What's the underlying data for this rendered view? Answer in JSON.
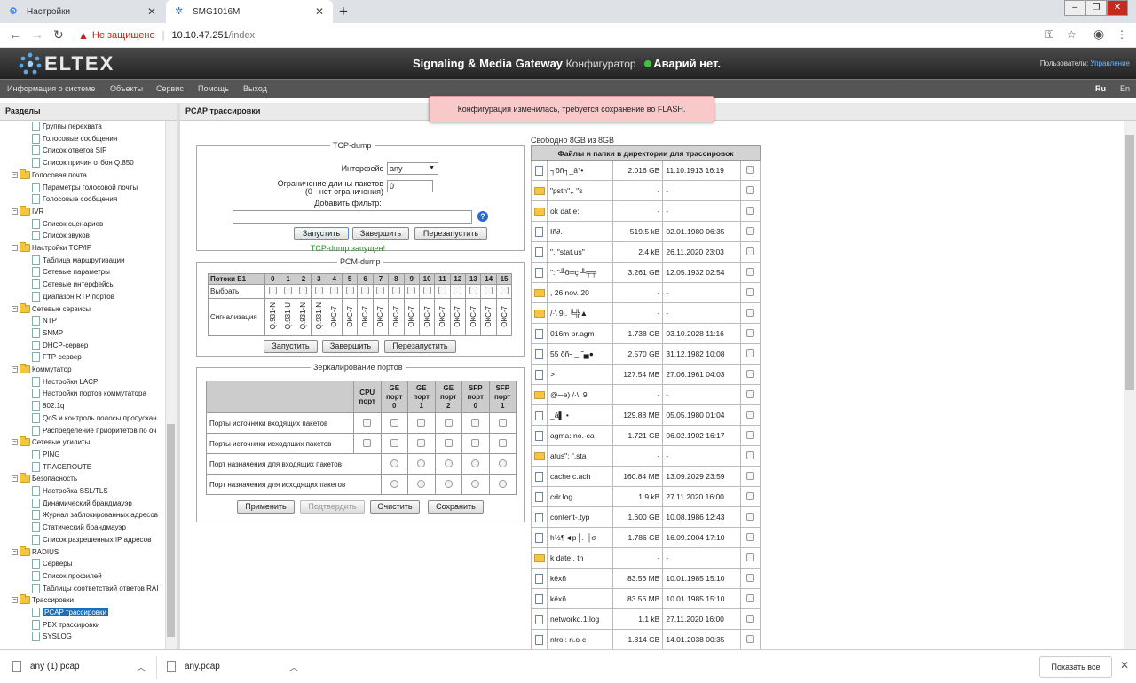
{
  "browser": {
    "tabs": [
      {
        "title": "Настройки",
        "active": false
      },
      {
        "title": "SMG1016M",
        "active": true
      }
    ],
    "insecure_label": "Не защищено",
    "url_host": "10.10.47.251",
    "url_path": "/index"
  },
  "header": {
    "logo_text": "ELTEX",
    "title": "Signaling & Media Gateway",
    "subtitle": "Конфигуратор",
    "alarm": "Аварий нет.",
    "user_label": "Пользователи:",
    "user_name": "Управление"
  },
  "menu": {
    "items": [
      "Информация о системе",
      "Объекты",
      "Сервис",
      "Помощь",
      "Выход"
    ],
    "lang_ru": "Ru",
    "lang_en": "En"
  },
  "sidebar": {
    "title": "Разделы",
    "tree": [
      {
        "type": "leaf",
        "label": "Группы перехвата"
      },
      {
        "type": "leaf",
        "label": "Голосовые сообщения"
      },
      {
        "type": "leaf",
        "label": "Список ответов SIP"
      },
      {
        "type": "leaf",
        "label": "Список причин отбоя Q.850"
      },
      {
        "type": "folder",
        "label": "Голосовая почта"
      },
      {
        "type": "leaf",
        "label": "Параметры голосовой почты"
      },
      {
        "type": "leaf",
        "label": "Голосовые сообщения"
      },
      {
        "type": "folder",
        "label": "IVR"
      },
      {
        "type": "leaf",
        "label": "Список сценариев"
      },
      {
        "type": "leaf",
        "label": "Список звуков"
      },
      {
        "type": "folder",
        "label": "Настройки TCP/IP"
      },
      {
        "type": "leaf",
        "label": "Таблица маршрутизации"
      },
      {
        "type": "leaf",
        "label": "Сетевые параметры"
      },
      {
        "type": "leaf",
        "label": "Сетевые интерфейсы"
      },
      {
        "type": "leaf",
        "label": "Диапазон RTP портов"
      },
      {
        "type": "folder",
        "label": "Сетевые сервисы"
      },
      {
        "type": "leaf",
        "label": "NTP"
      },
      {
        "type": "leaf",
        "label": "SNMP"
      },
      {
        "type": "leaf",
        "label": "DHCP-сервер"
      },
      {
        "type": "leaf",
        "label": "FTP-сервер"
      },
      {
        "type": "folder",
        "label": "Коммутатор"
      },
      {
        "type": "leaf",
        "label": "Настройки LACP"
      },
      {
        "type": "leaf",
        "label": "Настройки портов коммутатора"
      },
      {
        "type": "leaf",
        "label": "802.1q"
      },
      {
        "type": "leaf",
        "label": "QoS и контроль полосы пропускан"
      },
      {
        "type": "leaf",
        "label": "Распределение приоритетов по оч"
      },
      {
        "type": "folder",
        "label": "Сетевые утилиты"
      },
      {
        "type": "leaf",
        "label": "PING"
      },
      {
        "type": "leaf",
        "label": "TRACEROUTE"
      },
      {
        "type": "folder",
        "label": "Безопасность"
      },
      {
        "type": "leaf",
        "label": "Настройка SSL/TLS"
      },
      {
        "type": "leaf",
        "label": "Динамический брандмауэр"
      },
      {
        "type": "leaf",
        "label": "Журнал заблокированных адресов"
      },
      {
        "type": "leaf",
        "label": "Статический брандмауэр"
      },
      {
        "type": "leaf",
        "label": "Список разрешенных IP адресов"
      },
      {
        "type": "folder",
        "label": "RADIUS"
      },
      {
        "type": "leaf",
        "label": "Серверы"
      },
      {
        "type": "leaf",
        "label": "Список профилей"
      },
      {
        "type": "leaf",
        "label": "Таблицы соответствий ответов RAI"
      },
      {
        "type": "folder",
        "label": "Трассировки"
      },
      {
        "type": "leaf",
        "label": "PCAP трассировки",
        "selected": true
      },
      {
        "type": "leaf",
        "label": "PBX трассировки"
      },
      {
        "type": "leaf",
        "label": "SYSLOG"
      }
    ]
  },
  "main": {
    "title": "PCAP трассировки",
    "toast": "Конфигурация изменилась, требуется сохранение во FLASH.",
    "tcpdump": {
      "legend": "TCP-dump",
      "iface_label": "Интерфейс",
      "iface_value": "any",
      "limit_label1": "Ограничение длины пакетов",
      "limit_label2": "(0 - нет ограничения)",
      "limit_value": "0",
      "filter_label": "Добавить фильтр:",
      "filter_value": "",
      "start": "Запустить",
      "stop": "Завершить",
      "restart": "Перезапустить",
      "status": "TCP-dump запущен!"
    },
    "pcmdump": {
      "legend": "PCM-dump",
      "header_label": "Потоки E1",
      "streams": [
        "0",
        "1",
        "2",
        "3",
        "4",
        "5",
        "6",
        "7",
        "8",
        "9",
        "10",
        "11",
        "12",
        "13",
        "14",
        "15"
      ],
      "select_label": "Выбрать",
      "sig_label": "Сигнализация",
      "signaling": [
        "Q.931-N",
        "Q.931-U",
        "Q.931-N",
        "Q.931-N",
        "ОКС-7",
        "ОКС-7",
        "ОКС-7",
        "ОКС-7",
        "ОКС-7",
        "ОКС-7",
        "ОКС-7",
        "ОКС-7",
        "ОКС-7",
        "ОКС-7",
        "ОКС-7",
        "ОКС-7"
      ],
      "start": "Запустить",
      "stop": "Завершить",
      "restart": "Перезапустить"
    },
    "mirror": {
      "legend": "Зеркалирование портов",
      "cols": [
        [
          "CPU",
          "порт"
        ],
        [
          "GE",
          "порт",
          "0"
        ],
        [
          "GE",
          "порт",
          "1"
        ],
        [
          "GE",
          "порт",
          "2"
        ],
        [
          "SFP",
          "порт",
          "0"
        ],
        [
          "SFP",
          "порт",
          "1"
        ]
      ],
      "rows": [
        {
          "label": "Порты источники входящих пакетов",
          "kind": "check"
        },
        {
          "label": "Порты источники исходящих пакетов",
          "kind": "check"
        },
        {
          "label": "Порт назначения для входящих пакетов",
          "kind": "radio"
        },
        {
          "label": "Порт назначения для исходящих пакетов",
          "kind": "radio"
        }
      ],
      "apply": "Применить",
      "confirm": "Подтвердить",
      "clear": "Очистить",
      "save": "Сохранить"
    },
    "files": {
      "free": "Свободно 8GB из 8GB",
      "header": "Файлы и папки в директории для трассировок",
      "rows": [
        {
          "t": "file",
          "name": "┐õñ┐_â°•",
          "size": "2.016 GB",
          "date": "11.10.1913 16:19"
        },
        {
          "t": "folder",
          "name": "\"pstn\",. \"s",
          "size": "-",
          "date": "-"
        },
        {
          "t": "folder",
          "name": "ok dat.e:",
          "size": "-",
          "date": "-"
        },
        {
          "t": "file",
          "name": "Iñ∂.─",
          "size": "519.5 kB",
          "date": "02.01.1980 06:35"
        },
        {
          "t": "file",
          "name": "\", \"stat.us\"",
          "size": "2.4 kB",
          "date": "26.11.2020 23:03"
        },
        {
          "t": "file",
          "name": "\": \"╨õ╤ç ╨╤╤",
          "size": "3.261 GB",
          "date": "12.05.1932 02:54"
        },
        {
          "t": "folder",
          "name": ", 26 nov. 20",
          "size": "-",
          "date": "-"
        },
        {
          "t": "folder",
          "name": "/·\\ 9|. ╚╬▲",
          "size": "-",
          "date": "-"
        },
        {
          "t": "file",
          "name": "016m pr.agm",
          "size": "1.738 GB",
          "date": "03.10.2028 11:16"
        },
        {
          "t": "file",
          "name": "55 õñ┐_·˜▄●",
          "size": "2.570 GB",
          "date": "31.12.1982 10:08"
        },
        {
          "t": "file",
          "name": ">",
          "size": "127.54 MB",
          "date": "27.06.1961 04:03"
        },
        {
          "t": "folder",
          "name": "@─e) /·\\. 9",
          "size": "-",
          "date": "-"
        },
        {
          "t": "file",
          "name": "_â▌ •",
          "size": "129.88 MB",
          "date": "05.05.1980 01:04"
        },
        {
          "t": "file",
          "name": "agma: no.-ca",
          "size": "1.721 GB",
          "date": "06.02.1902 16:17"
        },
        {
          "t": "folder",
          "name": "atus\": \".sta",
          "size": "-",
          "date": "-"
        },
        {
          "t": "file",
          "name": "cache c.ach",
          "size": "160.84 MB",
          "date": "13.09.2029 23:59"
        },
        {
          "t": "file",
          "name": "cdr.log",
          "size": "1.9 kB",
          "date": "27.11.2020 16:00"
        },
        {
          "t": "file",
          "name": "content-.typ",
          "size": "1.600 GB",
          "date": "10.08.1986 12:43"
        },
        {
          "t": "file",
          "name": "h½¶◄p├. ╟σ",
          "size": "1.786 GB",
          "date": "16.09.2004 17:10"
        },
        {
          "t": "folder",
          "name": "k date:. th",
          "size": "-",
          "date": "-"
        },
        {
          "t": "file",
          "name": "kêxñ",
          "size": "83.56 MB",
          "date": "10.01.1985 15:10"
        },
        {
          "t": "file",
          "name": "kêxñ",
          "size": "83.56 MB",
          "date": "10.01.1985 15:10"
        },
        {
          "t": "file",
          "name": "networkd.1.log",
          "size": "1.1 kB",
          "date": "27.11.2020 16:00"
        },
        {
          "t": "file",
          "name": "ntrol: n.o-c",
          "size": "1.814 GB",
          "date": "14.01.2038 00:35"
        }
      ]
    }
  },
  "downloads": {
    "items": [
      "any (1).pcap",
      "any.pcap"
    ],
    "show_all": "Показать все"
  }
}
